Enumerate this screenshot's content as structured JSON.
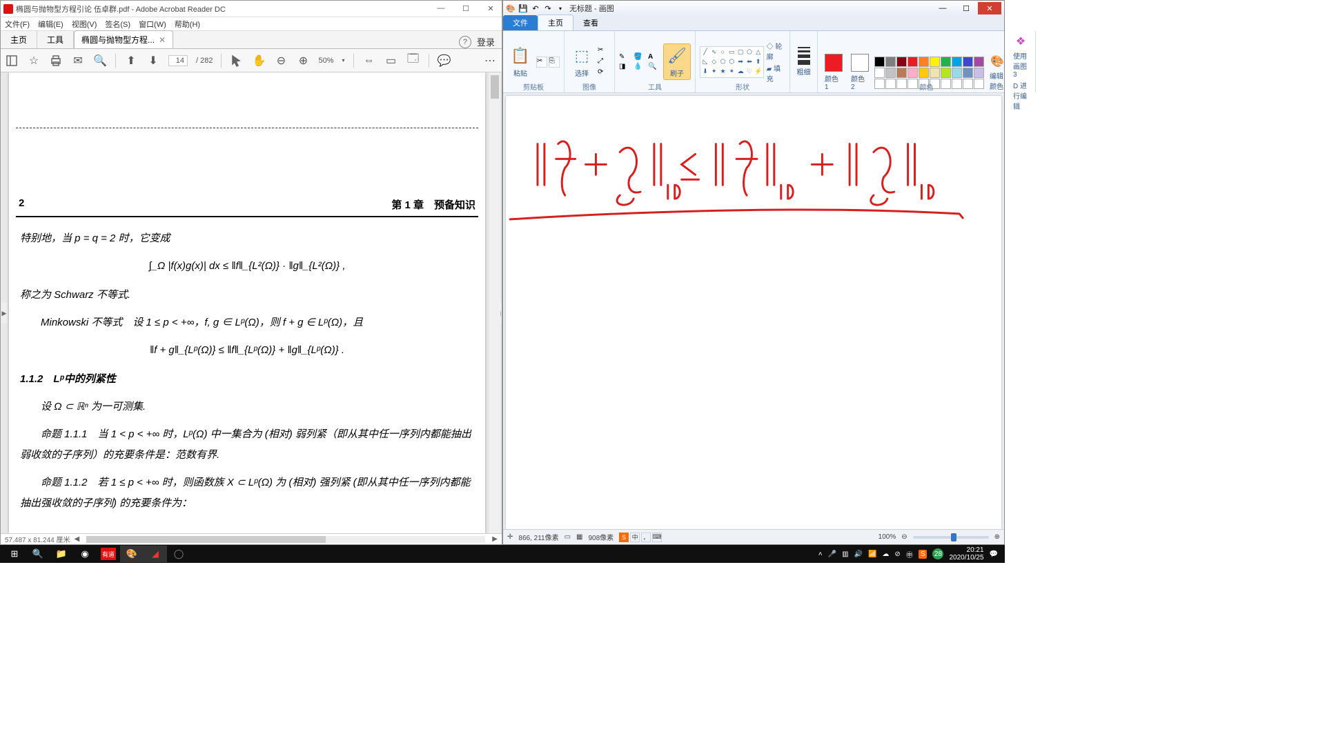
{
  "acrobat": {
    "title": "椭圆与抛物型方程引论 伍卓群.pdf - Adobe Acrobat Reader DC",
    "menu": [
      "文件(F)",
      "编辑(E)",
      "视图(V)",
      "签名(S)",
      "窗口(W)",
      "帮助(H)"
    ],
    "tabs": {
      "home": "主页",
      "tools": "工具",
      "file": "椭圆与抛物型方程...",
      "login": "登录"
    },
    "toolbar": {
      "page_cur": "14",
      "page_total": "/ 282",
      "zoom": "50%"
    },
    "page": {
      "num": "2",
      "chapter": "第 1 章　预备知识",
      "p1": "特别地，当 p = q = 2 时，它变成",
      "eq1": "∫_Ω |f(x)g(x)| dx ≤ ‖f‖_{L²(Ω)} · ‖g‖_{L²(Ω)} ,",
      "p2": "称之为 Schwarz 不等式.",
      "p3": "Minkowski 不等式　设 1 ≤ p < +∞，f, g ∈ Lᵖ(Ω)，则 f + g ∈ Lᵖ(Ω)，且",
      "eq2": "‖f + g‖_{Lᵖ(Ω)} ≤ ‖f‖_{Lᵖ(Ω)} + ‖g‖_{Lᵖ(Ω)} .",
      "sect": "1.1.2　Lᵖ中的列紧性",
      "p4": "设 Ω ⊂ ℝⁿ 为一可测集.",
      "p5": "命题 1.1.1　当 1 < p < +∞ 时，Lᵖ(Ω) 中一集合为 (相对) 弱列紧（即从其中任一序列内都能抽出弱收敛的子序列）的充要条件是：范数有界.",
      "p6": "命题 1.1.2　若 1 ≤ p < +∞ 时，则函数族 X ⊂ Lᵖ(Ω) 为 (相对) 强列紧 (即从其中任一序列内都能抽出强收敛的子序列) 的充要条件为："
    },
    "status": "57.487 x 81.244 厘米"
  },
  "paint": {
    "title": "无标题 - 画图",
    "tabs": {
      "file": "文件",
      "home": "主页",
      "view": "查看"
    },
    "groups": {
      "clipboard": "剪贴板",
      "image": "图像",
      "tools": "工具",
      "shapes": "形状",
      "colors": "颜色"
    },
    "btn": {
      "paste": "粘贴",
      "select": "选择",
      "brush": "刷子",
      "outline": "轮廓",
      "fill": "填充",
      "size": "粗细",
      "color1": "颜色 1",
      "color2": "颜色 2",
      "editcolors": "编辑颜色",
      "paint3d_a": "使用画图 3",
      "paint3d_b": "D 进行编辑"
    },
    "status": {
      "pos": "866, 211像素",
      "size": "908像素",
      "zoom": "100%"
    },
    "ime": {
      "zh": "中"
    }
  },
  "taskbar": {
    "time": "20:21",
    "date": "2020/10/25",
    "count": "28"
  },
  "palette_colors": [
    "#000000",
    "#7f7f7f",
    "#880015",
    "#ed1c24",
    "#ff7f27",
    "#fff200",
    "#22b14c",
    "#00a2e8",
    "#3f48cc",
    "#a349a4",
    "#ffffff",
    "#c3c3c3",
    "#b97a57",
    "#ffaec9",
    "#ffc90e",
    "#efe4b0",
    "#b5e61d",
    "#99d9ea",
    "#7092be",
    "#c8bfe7",
    "#ffffff",
    "#ffffff",
    "#ffffff",
    "#ffffff",
    "#ffffff",
    "#ffffff",
    "#ffffff",
    "#ffffff",
    "#ffffff",
    "#ffffff"
  ]
}
